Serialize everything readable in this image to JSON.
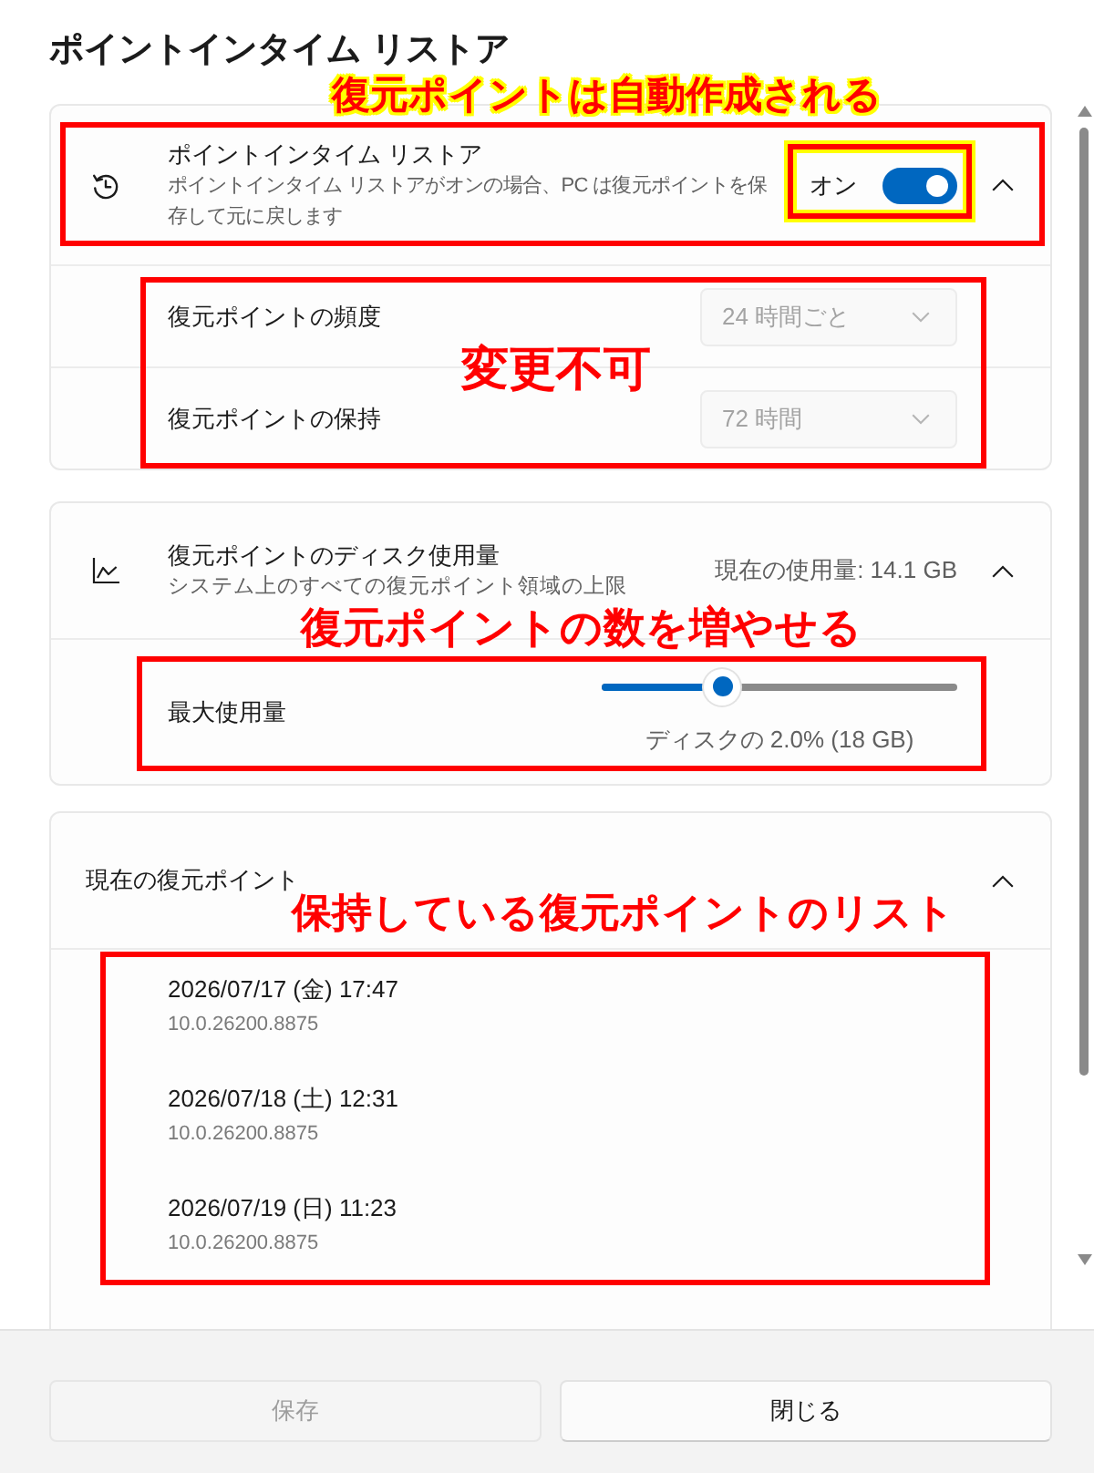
{
  "dialog": {
    "title": "ポイントインタイム リストア"
  },
  "restore_card": {
    "title": "ポイントインタイム リストア",
    "description": "ポイントインタイム リストアがオンの場合、PC は復元ポイントを保存して元に戻します",
    "toggle": {
      "label": "オン",
      "on": true
    },
    "expanded": true,
    "callout": {
      "text": "復元ポイントは自動作成される",
      "kind": "outlined"
    },
    "settings": [
      {
        "label": "復元ポイントの頻度",
        "value": "24 時間ごと",
        "disabled": true
      },
      {
        "label": "復元ポイントの保持",
        "value": "72 時間",
        "disabled": true
      }
    ],
    "settings_callout": {
      "text": "変更不可",
      "kind": "plain"
    }
  },
  "disk_card": {
    "title": "復元ポイントのディスク使用量",
    "description": "システム上のすべての復元ポイント領域の上限",
    "current_usage": "現在の使用量: 14.1 GB",
    "expanded": true,
    "callout": {
      "text": "復元ポイントの数を増やせる",
      "kind": "plain"
    },
    "slider": {
      "label": "最大使用量",
      "level": 0.34,
      "reading": "ディスクの 2.0% (18 GB)"
    }
  },
  "points_card": {
    "title": "現在の復元ポイント",
    "expanded": true,
    "callout": {
      "text": "保持している復元ポイントのリスト",
      "kind": "plain"
    },
    "items": [
      {
        "date": "2026/07/17 (金) 17:47",
        "version": "10.0.26200.8875"
      },
      {
        "date": "2026/07/18 (土) 12:31",
        "version": "10.0.26200.8875"
      },
      {
        "date": "2026/07/19 (日) 11:23",
        "version": "10.0.26200.8875"
      }
    ]
  },
  "buttons": [
    {
      "label": "保存",
      "disabled": true
    },
    {
      "label": "閉じる",
      "disabled": false
    }
  ]
}
